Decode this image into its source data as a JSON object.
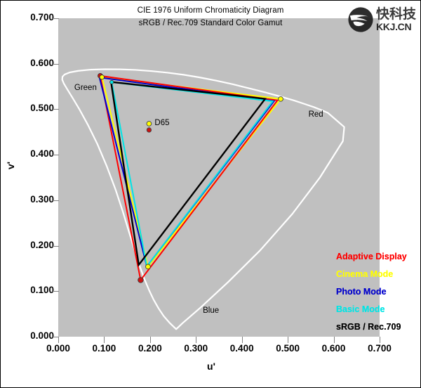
{
  "chart_data": {
    "type": "scatter",
    "title": "CIE 1976 Uniform Chromaticity Diagram",
    "subtitle": "sRGB / Rec.709 Standard Color Gamut",
    "xlabel": "u'",
    "ylabel": "v'",
    "xlim": [
      0.0,
      0.7
    ],
    "ylim": [
      0.0,
      0.7
    ],
    "xticks": [
      "0.000",
      "0.100",
      "0.200",
      "0.300",
      "0.400",
      "0.500",
      "0.600",
      "0.700"
    ],
    "yticks": [
      "0.000",
      "0.100",
      "0.200",
      "0.300",
      "0.400",
      "0.500",
      "0.600",
      "0.700"
    ],
    "grid": false,
    "legend_position": "inside-bottom-right",
    "plot_background": "#c0c0c0",
    "locus_color": "#ffffff",
    "region_labels": [
      {
        "text": "Green",
        "u": 0.035,
        "v": 0.545
      },
      {
        "text": "Red",
        "u": 0.545,
        "v": 0.487
      },
      {
        "text": "Blue",
        "u": 0.315,
        "v": 0.055
      }
    ],
    "white_point": {
      "label": "D65",
      "u": 0.1978,
      "v": 0.4683,
      "marker_top_color": "#ffff00",
      "marker_bottom_color": "#cc1111"
    },
    "series": [
      {
        "name": "Adaptive Display",
        "color": "#ff0000",
        "vertices": [
          {
            "u": 0.0915,
            "v": 0.5735
          },
          {
            "u": 0.4775,
            "v": 0.5195
          },
          {
            "u": 0.1795,
            "v": 0.1245
          }
        ],
        "markers": [
          "#cc1111",
          "#ffff00",
          "#cc1111"
        ]
      },
      {
        "name": "Cinema Mode",
        "color": "#ffff00",
        "vertices": [
          {
            "u": 0.0952,
            "v": 0.5705
          },
          {
            "u": 0.4845,
            "v": 0.5225
          },
          {
            "u": 0.1955,
            "v": 0.154
          }
        ],
        "markers": [
          "#ffff00",
          "#ffff00",
          "#ffff00"
        ]
      },
      {
        "name": "Photo Mode",
        "color": "#0000cc",
        "vertices": [
          {
            "u": 0.0898,
            "v": 0.57
          },
          {
            "u": 0.47,
            "v": 0.518
          },
          {
            "u": 0.193,
            "v": 0.1545
          }
        ],
        "markers": [
          "#0000cc",
          "#0000cc",
          "#0000cc"
        ]
      },
      {
        "name": "Basic Mode",
        "color": "#00e5e5",
        "vertices": [
          {
            "u": 0.1165,
            "v": 0.5595
          },
          {
            "u": 0.4672,
            "v": 0.5175
          },
          {
            "u": 0.193,
            "v": 0.1545
          }
        ],
        "markers": [
          "#00e5e5",
          "#00e5e5",
          "#00e5e5"
        ]
      },
      {
        "name": "sRGB / Rec.709",
        "color": "#000000",
        "vertices": [
          {
            "u": 0.115,
            "v": 0.56
          },
          {
            "u": 0.4507,
            "v": 0.5229
          },
          {
            "u": 0.1754,
            "v": 0.1579
          }
        ],
        "markers": [
          "#000000",
          "#000000",
          "#000000"
        ]
      }
    ],
    "spectral_locus": [
      {
        "u": 0.2569,
        "v": 0.0165
      },
      {
        "u": 0.243,
        "v": 0.03
      },
      {
        "u": 0.2296,
        "v": 0.0455
      },
      {
        "u": 0.2184,
        "v": 0.0625
      },
      {
        "u": 0.2079,
        "v": 0.081
      },
      {
        "u": 0.198,
        "v": 0.102
      },
      {
        "u": 0.188,
        "v": 0.126
      },
      {
        "u": 0.178,
        "v": 0.154
      },
      {
        "u": 0.167,
        "v": 0.188
      },
      {
        "u": 0.1545,
        "v": 0.229
      },
      {
        "u": 0.141,
        "v": 0.274
      },
      {
        "u": 0.125,
        "v": 0.323
      },
      {
        "u": 0.106,
        "v": 0.374
      },
      {
        "u": 0.0855,
        "v": 0.423
      },
      {
        "u": 0.0645,
        "v": 0.466
      },
      {
        "u": 0.0455,
        "v": 0.501
      },
      {
        "u": 0.03,
        "v": 0.527
      },
      {
        "u": 0.019,
        "v": 0.545
      },
      {
        "u": 0.012,
        "v": 0.557
      },
      {
        "u": 0.0087,
        "v": 0.565
      },
      {
        "u": 0.0092,
        "v": 0.5715
      },
      {
        "u": 0.014,
        "v": 0.5765
      },
      {
        "u": 0.025,
        "v": 0.581
      },
      {
        "u": 0.044,
        "v": 0.5845
      },
      {
        "u": 0.07,
        "v": 0.587
      },
      {
        "u": 0.101,
        "v": 0.588
      },
      {
        "u": 0.134,
        "v": 0.5878
      },
      {
        "u": 0.168,
        "v": 0.5865
      },
      {
        "u": 0.202,
        "v": 0.584
      },
      {
        "u": 0.237,
        "v": 0.5805
      },
      {
        "u": 0.272,
        "v": 0.576
      },
      {
        "u": 0.308,
        "v": 0.57
      },
      {
        "u": 0.344,
        "v": 0.563
      },
      {
        "u": 0.38,
        "v": 0.555
      },
      {
        "u": 0.416,
        "v": 0.546
      },
      {
        "u": 0.451,
        "v": 0.537
      },
      {
        "u": 0.484,
        "v": 0.528
      },
      {
        "u": 0.513,
        "v": 0.5195
      },
      {
        "u": 0.537,
        "v": 0.5115
      },
      {
        "u": 0.556,
        "v": 0.505
      },
      {
        "u": 0.57,
        "v": 0.4995
      },
      {
        "u": 0.5805,
        "v": 0.495
      },
      {
        "u": 0.5875,
        "v": 0.492
      },
      {
        "u": 0.623,
        "v": 0.461
      },
      {
        "u": 0.62,
        "v": 0.43
      },
      {
        "u": 0.57,
        "v": 0.35
      },
      {
        "u": 0.51,
        "v": 0.27
      },
      {
        "u": 0.44,
        "v": 0.19
      },
      {
        "u": 0.37,
        "v": 0.12
      },
      {
        "u": 0.31,
        "v": 0.064
      },
      {
        "u": 0.27,
        "v": 0.029
      },
      {
        "u": 0.2569,
        "v": 0.0165
      }
    ]
  },
  "legend": {
    "entries": [
      {
        "label": "Adaptive Display",
        "color": "#ff0000"
      },
      {
        "label": "Cinema Mode",
        "color": "#ffff00"
      },
      {
        "label": "Photo Mode",
        "color": "#0000cc"
      },
      {
        "label": "Basic Mode",
        "color": "#00e5e5"
      },
      {
        "label": "sRGB / Rec.709",
        "color": "#000000"
      }
    ]
  },
  "watermark": {
    "chinese": "快科技",
    "english": "KKJ.CN"
  }
}
